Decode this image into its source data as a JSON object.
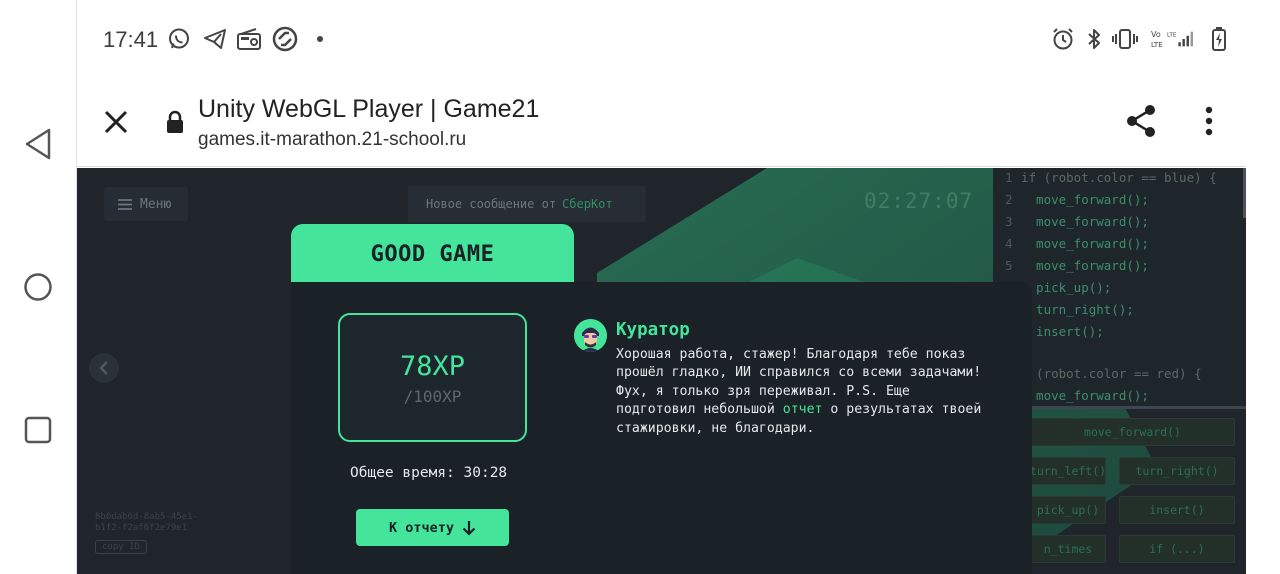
{
  "status_bar": {
    "time": "17:41",
    "left_icons": [
      "whatsapp-icon",
      "telegram-icon",
      "radio-icon",
      "sync-icon",
      "dot-icon"
    ],
    "right_icons": [
      "alarm-icon",
      "bluetooth-icon",
      "vibrate-icon",
      "volte-icon",
      "signal-icon",
      "battery-icon"
    ]
  },
  "browser": {
    "title": "Unity WebGL Player | Game21",
    "url": "games.it-marathon.21-school.ru"
  },
  "game": {
    "menu_label": "Меню",
    "message_prefix": "Новое сообщение от",
    "message_sender": "СберКот",
    "timer": "02:27:07",
    "user_id": "8b0dab0d-8ab5-45e1-b1f2-f2af6f2e79e1",
    "copy_id_label": "copy ID",
    "code_lines": [
      {
        "n": "1",
        "t": "if (robot.color == blue) {"
      },
      {
        "n": "2",
        "t": "  move_forward();"
      },
      {
        "n": "3",
        "t": "  move_forward();"
      },
      {
        "n": "4",
        "t": "  move_forward();"
      },
      {
        "n": "5",
        "t": "  move_forward();"
      },
      {
        "n": "",
        "t": "  pick_up();"
      },
      {
        "n": "",
        "t": "  turn_right();"
      },
      {
        "n": "",
        "t": "  insert();"
      },
      {
        "n": "",
        "t": ""
      },
      {
        "n": "",
        "t": "  (robot.color == red) {"
      },
      {
        "n": "",
        "t": "  move_forward();"
      }
    ],
    "commands": [
      "move_forward()",
      "turn_left()",
      "turn_right()",
      "pick_up()",
      "insert()",
      "n_times",
      "if (...)"
    ]
  },
  "modal": {
    "tab_title": "GOOD GAME",
    "xp_value": "78XP",
    "xp_max": "/100XP",
    "total_time_label": "Общее время:",
    "total_time_value": "30:28",
    "report_button": "К отчету",
    "curator_name": "Куратор",
    "message_part1": "Хорошая работа, стажер! Благодаря тебе показ прошёл гладко, ИИ справился со всеми задачами! Фух, я только зря переживал. P.S. Еще подготовил небольшой",
    "message_link": "отчет",
    "message_part2": "о результатах твоей стажировки, не благодари."
  },
  "colors": {
    "accent": "#44e59b",
    "game_bg": "#1f252b",
    "modal_bg": "#1a2127"
  }
}
